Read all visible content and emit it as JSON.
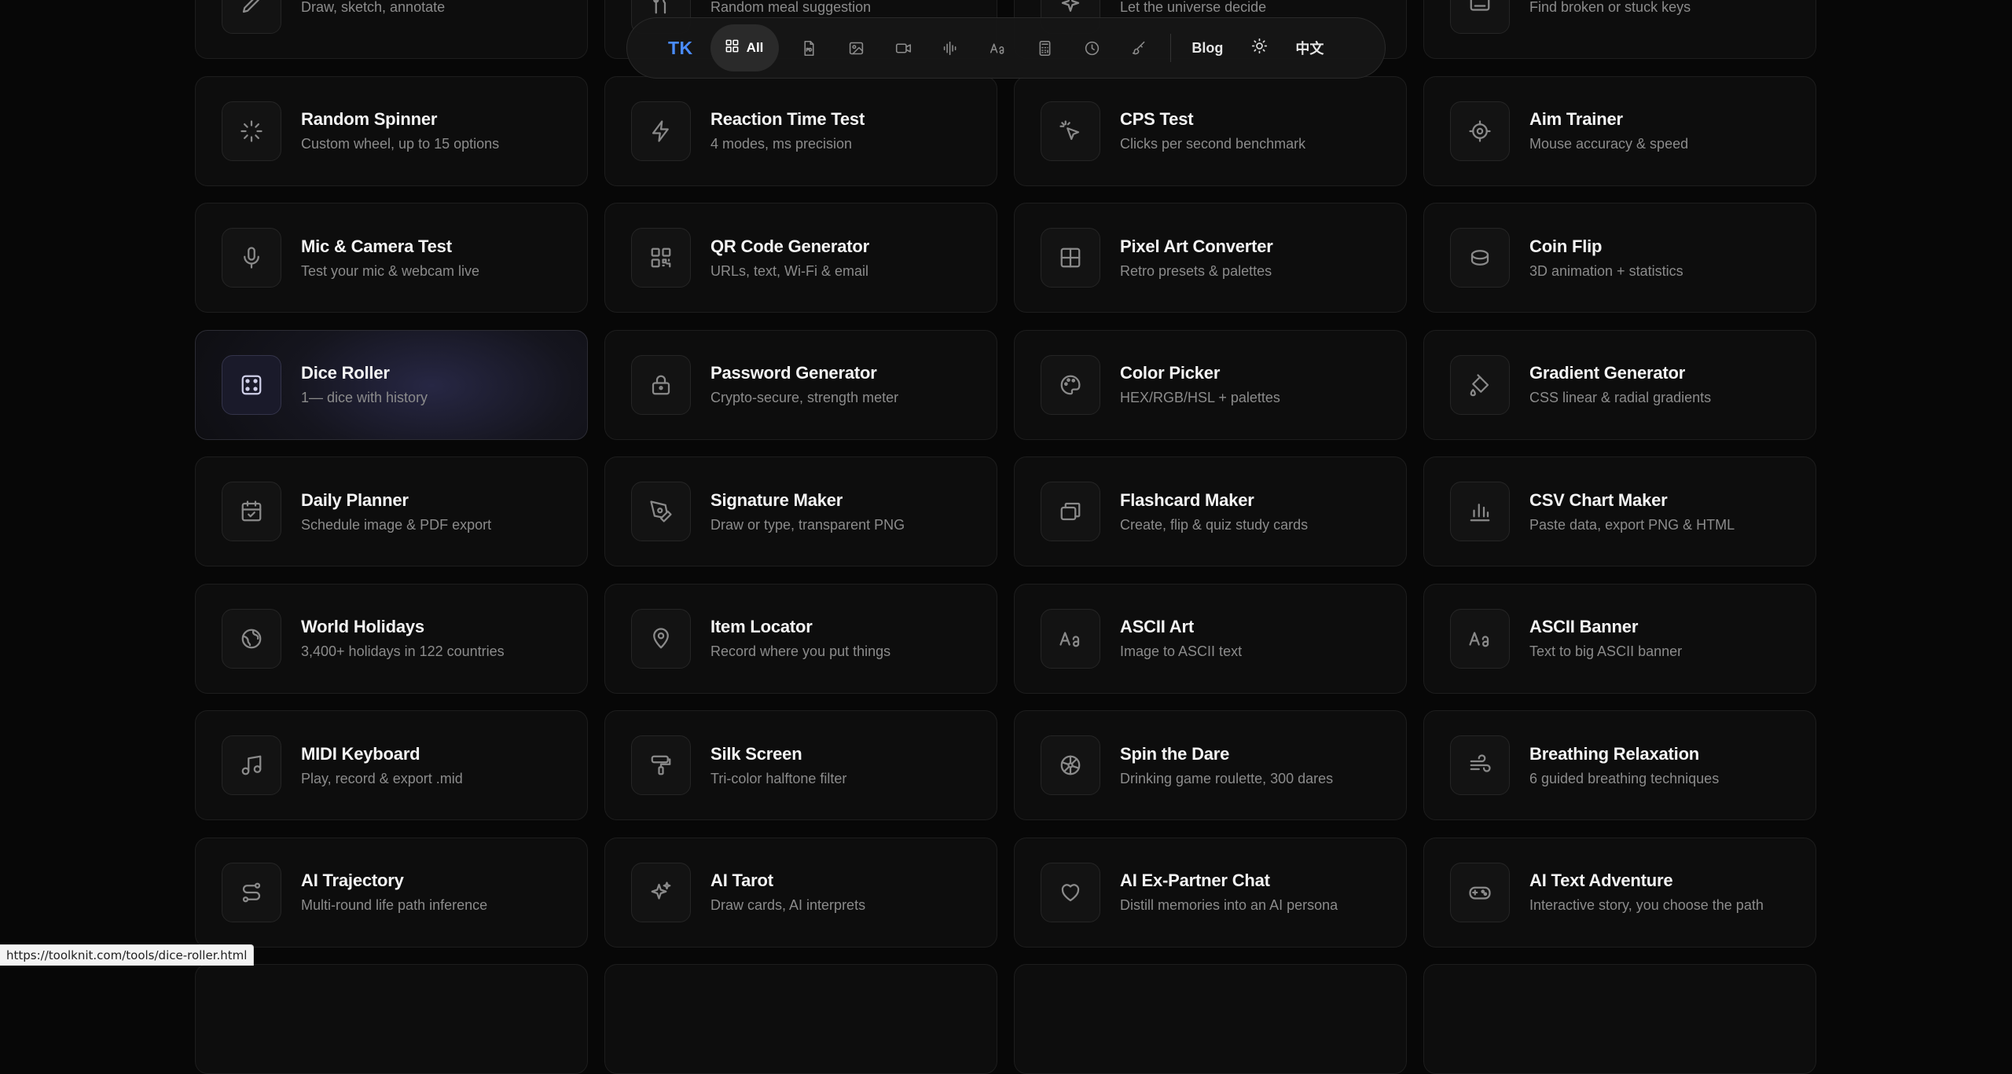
{
  "nav": {
    "logo": "TK",
    "all_label": "All",
    "category_icons": [
      "pdf-icon",
      "image-icon",
      "video-icon",
      "audio-icon",
      "text-icon",
      "calculator-icon",
      "clock-icon",
      "brush-icon"
    ],
    "blog_label": "Blog",
    "theme_icon": "sun-icon",
    "lang_label": "中文"
  },
  "tools": [
    {
      "title": "",
      "desc": "Draw, sketch, annotate",
      "icon": "pen-icon"
    },
    {
      "title": "",
      "desc": "Random meal suggestion",
      "icon": "fork-icon"
    },
    {
      "title": "",
      "desc": "Let the universe decide",
      "icon": "sparkle-icon"
    },
    {
      "title": "",
      "desc": "Find broken or stuck keys",
      "icon": "keyboard-icon"
    },
    {
      "title": "Random Spinner",
      "desc": "Custom wheel, up to 15 options",
      "icon": "loader-icon"
    },
    {
      "title": "Reaction Time Test",
      "desc": "4 modes, ms precision",
      "icon": "zap-icon"
    },
    {
      "title": "CPS Test",
      "desc": "Clicks per second benchmark",
      "icon": "cursor-click-icon"
    },
    {
      "title": "Aim Trainer",
      "desc": "Mouse accuracy & speed",
      "icon": "crosshair-icon"
    },
    {
      "title": "Mic & Camera Test",
      "desc": "Test your mic & webcam live",
      "icon": "mic-icon"
    },
    {
      "title": "QR Code Generator",
      "desc": "URLs, text, Wi-Fi & email",
      "icon": "qr-icon"
    },
    {
      "title": "Pixel Art Converter",
      "desc": "Retro presets & palettes",
      "icon": "grid-icon"
    },
    {
      "title": "Coin Flip",
      "desc": "3D animation + statistics",
      "icon": "coin-icon"
    },
    {
      "title": "Dice Roller",
      "desc": "1— dice with history",
      "icon": "dice-icon",
      "active": true
    },
    {
      "title": "Password Generator",
      "desc": "Crypto-secure, strength meter",
      "icon": "lock-icon"
    },
    {
      "title": "Color Picker",
      "desc": "HEX/RGB/HSL + palettes",
      "icon": "palette-icon"
    },
    {
      "title": "Gradient Generator",
      "desc": "CSS linear & radial gradients",
      "icon": "paint-bucket-icon"
    },
    {
      "title": "Daily Planner",
      "desc": "Schedule image & PDF export",
      "icon": "calendar-check-icon"
    },
    {
      "title": "Signature Maker",
      "desc": "Draw or type, transparent PNG",
      "icon": "pen-tool-icon"
    },
    {
      "title": "Flashcard Maker",
      "desc": "Create, flip & quiz study cards",
      "icon": "cards-icon"
    },
    {
      "title": "CSV Chart Maker",
      "desc": "Paste data, export PNG & HTML",
      "icon": "bar-chart-icon"
    },
    {
      "title": "World Holidays",
      "desc": "3,400+ holidays in 122 countries",
      "icon": "globe-icon"
    },
    {
      "title": "Item Locator",
      "desc": "Record where you put things",
      "icon": "map-pin-icon"
    },
    {
      "title": "ASCII Art",
      "desc": "Image to ASCII text",
      "icon": "type-icon"
    },
    {
      "title": "ASCII Banner",
      "desc": "Text to big ASCII banner",
      "icon": "type-icon"
    },
    {
      "title": "MIDI Keyboard",
      "desc": "Play, record & export .mid",
      "icon": "music-icon"
    },
    {
      "title": "Silk Screen",
      "desc": "Tri-color halftone filter",
      "icon": "paint-roller-icon"
    },
    {
      "title": "Spin the Dare",
      "desc": "Drinking game roulette, 300 dares",
      "icon": "wheel-icon"
    },
    {
      "title": "Breathing Relaxation",
      "desc": "6 guided breathing techniques",
      "icon": "wind-icon"
    },
    {
      "title": "AI Trajectory",
      "desc": "Multi-round life path inference",
      "icon": "route-icon"
    },
    {
      "title": "AI Tarot",
      "desc": "Draw cards, AI interprets",
      "icon": "sparkles-icon"
    },
    {
      "title": "AI Ex-Partner Chat",
      "desc": "Distill memories into an AI persona",
      "icon": "heart-icon"
    },
    {
      "title": "AI Text Adventure",
      "desc": "Interactive story, you choose the path",
      "icon": "gamepad-icon"
    },
    {
      "title": "",
      "desc": "",
      "icon": ""
    },
    {
      "title": "",
      "desc": "",
      "icon": ""
    },
    {
      "title": "",
      "desc": "",
      "icon": ""
    },
    {
      "title": "",
      "desc": "",
      "icon": ""
    }
  ],
  "status_url": "https://toolknit.com/tools/dice-roller.html",
  "colors": {
    "accent": "#4a8cff",
    "background": "#070707",
    "card": "#0d0d0d"
  }
}
